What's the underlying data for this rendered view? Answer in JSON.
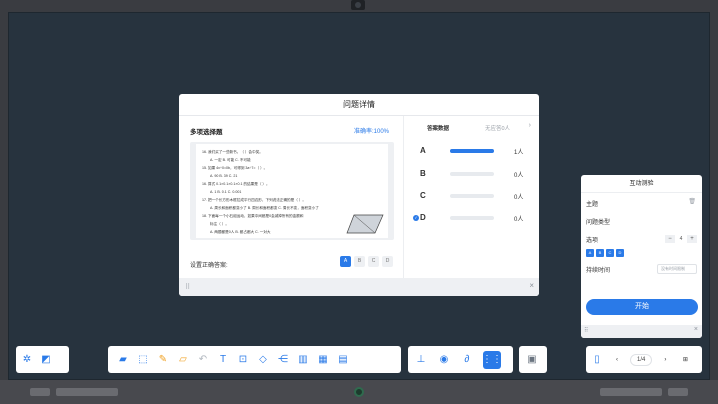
{
  "dialog": {
    "title": "问题详情",
    "question_type": "多项选择题",
    "accuracy": "准确率:100%",
    "paper_lines": [
      "16. 我们买了一些新书。（    ）会中奖。",
      "A. 一定             B. 可能             C. 不可能",
      "15. 如果 4x÷0=0b，可得到 3a÷7=（     ）。",
      "A. 90               B. 39               C. 21",
      "16. 算式 0.1×0.1×0.1×0.1 的结果是（     ）。",
      "A. 1                B. 0.1              C. 0.001",
      "17. 把一个长方形木框拉成平行四边形，下列说法正确的是（     ）。",
      "A. 周长和面积都变小了      B. 周长和面积都变   C. 周长不变，面积变小了",
      "18. 下面每一个小石组运动，如果中间都是0会减掉所有的金额和",
      "标注（     ）。",
      "A. 两题都是0人            B. 都占都大          C. 一对大"
    ],
    "set_answer_label": "设置正确答案:",
    "answer_options": [
      "A",
      "B",
      "C",
      "D"
    ],
    "selected_option": "A",
    "answer_data_title": "答案数据",
    "no_answer": "无应答0人",
    "results": [
      {
        "label": "A",
        "count": "1人",
        "ratio": 1.0,
        "checked": false
      },
      {
        "label": "B",
        "count": "0人",
        "ratio": 0.0,
        "checked": false
      },
      {
        "label": "C",
        "count": "0人",
        "ratio": 0.0,
        "checked": false
      },
      {
        "label": "D",
        "count": "0人",
        "ratio": 0.0,
        "checked": true
      }
    ],
    "close_icon": "×"
  },
  "panel": {
    "title": "互动测验",
    "topic_label": "主题",
    "type_label": "问题类型",
    "options_label": "选项",
    "option_count": "4",
    "option_chips": [
      "A",
      "B",
      "C",
      "D"
    ],
    "duration_label": "持续时间",
    "duration_value": "没有时间限制",
    "start_button": "开始",
    "close_icon": "×"
  },
  "toolbar": {
    "page_indicator": "1/4"
  },
  "colors": {
    "accent": "#2a7ae8",
    "screen": "#27333e"
  }
}
